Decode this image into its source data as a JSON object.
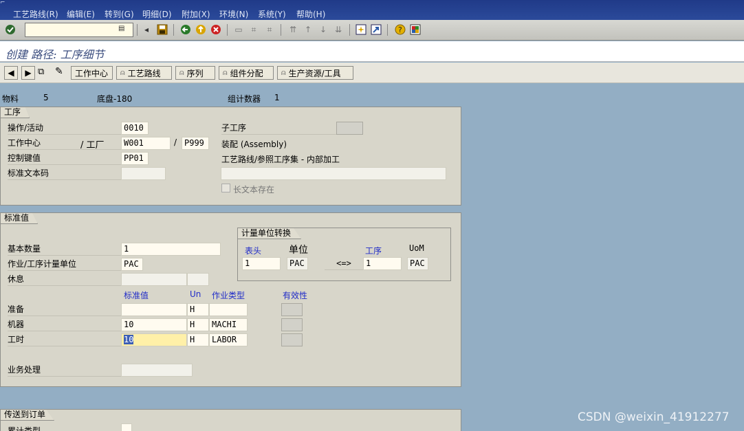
{
  "menubar": {
    "items": [
      "工艺路线(R)",
      "编辑(E)",
      "转到(G)",
      "明细(D)",
      "附加(X)",
      "环境(N)",
      "系统(Y)",
      "帮助(H)"
    ]
  },
  "toolbar": {
    "icons": [
      "enter-icon",
      "save-icon",
      "back-icon",
      "exit-icon",
      "cancel-icon",
      "print-icon",
      "find-icon",
      "find-next-icon",
      "first-page-icon",
      "prev-page-icon",
      "next-page-icon",
      "last-page-icon",
      "create-session-icon",
      "shortcut-icon",
      "help-icon",
      "layout-icon"
    ]
  },
  "title": "创建 路径: 工序细节",
  "app_toolbar": {
    "buttons": [
      "工作中心",
      "工艺路线",
      "序列",
      "组件分配",
      "生产资源/工具"
    ]
  },
  "header": {
    "material_label": "物料",
    "material_value": "5",
    "material_desc": "底盘-180",
    "group_counter_label": "组计数器",
    "group_counter_value": "1"
  },
  "operation": {
    "tab": "工序",
    "activity_label": "操作/活动",
    "activity_value": "0010",
    "workcenter_label": "工作中心",
    "plant_label": "/ 工厂",
    "workcenter_value": "W001",
    "slash": "/",
    "plant_value": "P999",
    "control_key_label": "控制键值",
    "control_key_value": "PP01",
    "std_text_label": "标准文本码",
    "std_text_value": "",
    "suboperation_label": "子工序",
    "assembly_text": "装配 (Assembly)",
    "routing_text": "工艺路线/参照工序集 - 内部加工",
    "longtext_label": "长文本存在"
  },
  "standard": {
    "tab": "标准值",
    "base_qty_label": "基本数量",
    "base_qty_value": "1",
    "unit_label": "作业/工序计量单位",
    "unit_value": "PAC",
    "break_label": "休息",
    "col_std": "标准值",
    "col_un": "Un",
    "col_type": "作业类型",
    "col_valid": "有效性",
    "rows": [
      {
        "label": "准备",
        "value": "",
        "un": "H",
        "type": ""
      },
      {
        "label": "机器",
        "value": "10",
        "un": "H",
        "type": "MACHI"
      },
      {
        "label": "工时",
        "value": "10",
        "un": "H",
        "type": "LABOR"
      }
    ],
    "business_label": "业务处理"
  },
  "conversion": {
    "tab": "计量单位转换",
    "header_label": "表头",
    "unit_label": "单位",
    "op_label": "工序",
    "uom_label": "UoM",
    "header_value": "1",
    "header_unit": "PAC",
    "arrow": "<=>",
    "op_value": "1",
    "op_unit": "PAC"
  },
  "transfer": {
    "tab": "传送到订单",
    "cost_type_label": "累计类型"
  },
  "watermark": "CSDN @weixin_41912277"
}
